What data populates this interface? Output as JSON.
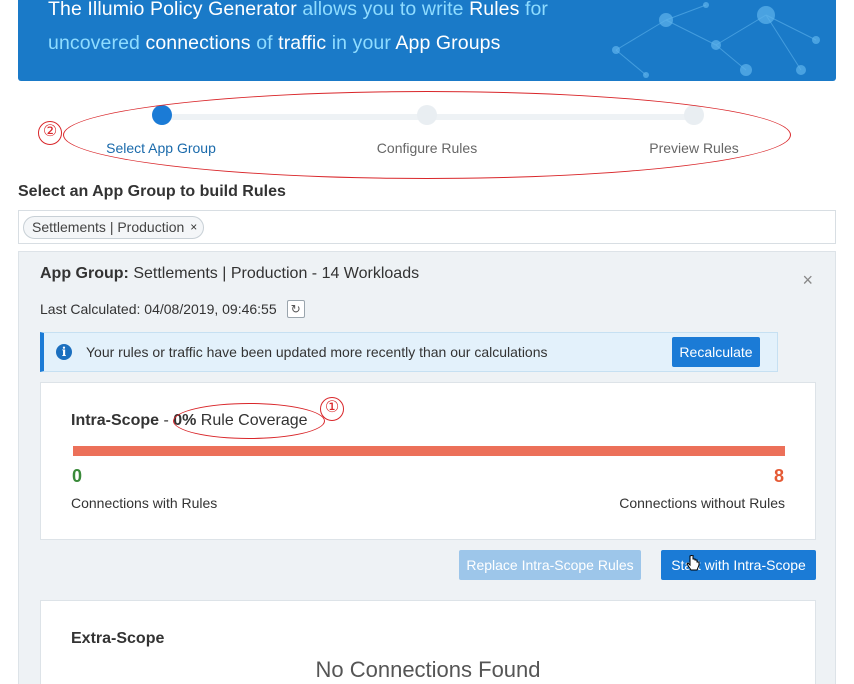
{
  "banner": {
    "line1_part1": "The Illumio Policy Generator",
    "line1_part2": " allows you to write ",
    "line1_part3": "Rules",
    "line1_part4": " for",
    "line2_part1": "uncovered",
    "line2_part2": " connections ",
    "line2_part3": "of",
    "line2_part4": " traffic ",
    "line2_part5": "in your",
    "line2_part6": " App Groups"
  },
  "stepper": {
    "steps": [
      {
        "label": "Select App Group",
        "active": true
      },
      {
        "label": "Configure Rules",
        "active": false
      },
      {
        "label": "Preview Rules",
        "active": false
      }
    ],
    "annotation_number": "②"
  },
  "section": {
    "title": "Select an App Group to build Rules"
  },
  "selector": {
    "tag_label": "Settlements | Production",
    "tag_remove": "×"
  },
  "panel": {
    "title_label": "App Group:",
    "title_value": " Settlements | Production - 14 Workloads",
    "close": "×",
    "last_calculated": "Last Calculated: 04/08/2019, 09:46:55",
    "refresh_glyph": "↻",
    "info": {
      "icon_glyph": "i",
      "text": "Your rules or traffic have been updated more recently than our calculations",
      "button": "Recalculate"
    }
  },
  "intra_scope": {
    "title": "Intra-Scope",
    "separator": " - ",
    "coverage_pct": "0%",
    "coverage_label": " Rule Coverage",
    "annotation_number": "①",
    "with_rules_count": "0",
    "with_rules_label": "Connections with Rules",
    "without_rules_count": "8",
    "without_rules_label": "Connections without Rules",
    "coverage_fraction": 0.0
  },
  "actions": {
    "replace_button": "Replace Intra-Scope Rules",
    "start_button": "Start with Intra-Scope"
  },
  "extra_scope": {
    "title": "Extra-Scope",
    "empty_text": "No Connections Found"
  },
  "colors": {
    "banner_bg": "#1a7ac8",
    "primary": "#1b7bd6",
    "coverage_bar": "#ec7059",
    "count_green": "#3a8a3a",
    "count_orange": "#e55a35",
    "annotation_red": "#d9262a"
  }
}
